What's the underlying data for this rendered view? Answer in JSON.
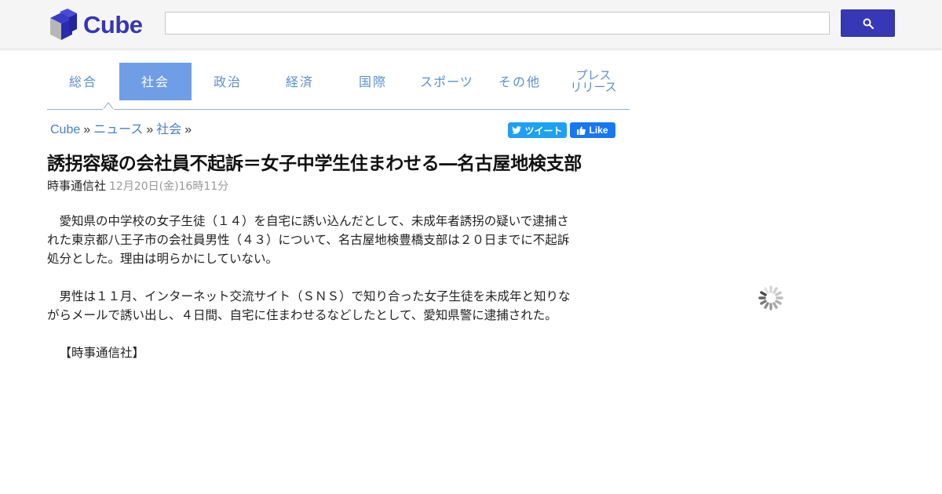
{
  "header": {
    "logo_text": "Cube",
    "search": {
      "value": "",
      "placeholder": ""
    },
    "brand_color": "#3536b8"
  },
  "nav": {
    "tabs": [
      {
        "label": "総合",
        "active": false
      },
      {
        "label": "社会",
        "active": true
      },
      {
        "label": "政治",
        "active": false
      },
      {
        "label": "経済",
        "active": false
      },
      {
        "label": "国際",
        "active": false
      },
      {
        "label": "スポーツ",
        "active": false
      },
      {
        "label": "その他",
        "active": false
      },
      {
        "label_line1": "プレス",
        "label_line2": "リリース",
        "active": false
      }
    ],
    "active_color": "#6f9ee6"
  },
  "breadcrumb": {
    "items": [
      "Cube",
      "ニュース",
      "社会"
    ],
    "separator": "»"
  },
  "social": {
    "tweet_label": "ツイート",
    "like_label": "Like"
  },
  "article": {
    "title": "誘拐容疑の会社員不起訴＝女子中学生住まわせる―名古屋地検支部",
    "source": "時事通信社",
    "date": "12月20日(金)16時11分",
    "paragraphs": [
      "愛知県の中学校の女子生徒（１４）を自宅に誘い込んだとして、未成年者誘拐の疑いで逮捕された東京都八王子市の会社員男性（４３）について、名古屋地検豊橋支部は２０日までに不起訴処分とした。理由は明らかにしていない。",
      "男性は１１月、インターネット交流サイト（ＳＮＳ）で知り合った女子生徒を未成年と知りながらメールで誘い出し、４日間、自宅に住まわせるなどしたとして、愛知県警に逮捕された。",
      "【時事通信社】"
    ]
  }
}
